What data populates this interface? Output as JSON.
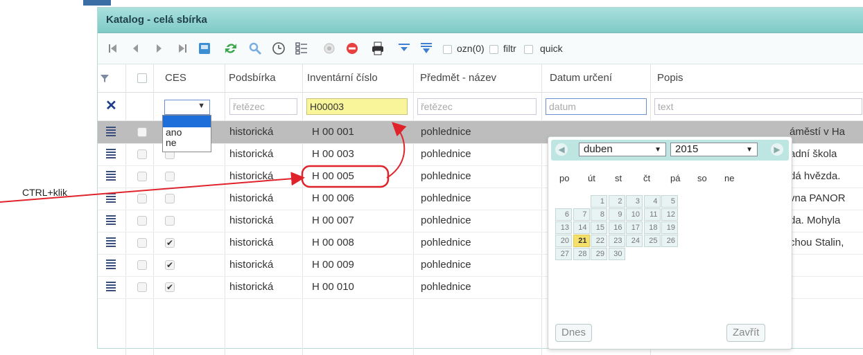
{
  "window": {
    "title": "Katalog - celá sbírka"
  },
  "toolbar": {
    "icons": [
      "first-icon",
      "prev-icon",
      "next-icon",
      "last-icon",
      "export-icon",
      "refresh-icon",
      "search-icon",
      "clock-icon",
      "columns-icon",
      "circle-icon",
      "delete-icon",
      "print-icon",
      "filter-down-icon",
      "filter-clear-icon"
    ],
    "ozn_label": "ozn(0)",
    "filtr_label": "filtr",
    "quick_label": "quick"
  },
  "columns": [
    "CES",
    "Podsbírka",
    "Inventární číslo",
    "Předmět - název",
    "Datum určení",
    "Popis"
  ],
  "filters": {
    "podsbirka_placeholder": "řetězec",
    "inventarni_value": "H00003",
    "predmet_placeholder": "řetězec",
    "datum_placeholder": "datum",
    "popis_placeholder": "text"
  },
  "ces_dropdown": {
    "options": [
      "",
      "ano",
      "ne"
    ]
  },
  "rows": [
    {
      "podsbirka": "historická",
      "inv": "H 00 001",
      "predmet": "pohlednice",
      "popis": "áměstí v Ha",
      "ces": false
    },
    {
      "podsbirka": "historická",
      "inv": "H 00 003",
      "predmet": "pohlednice",
      "popis": "adní škola",
      "ces": false
    },
    {
      "podsbirka": "historická",
      "inv": "H 00 005",
      "predmet": "pohlednice",
      "popis": "dá hvězda.",
      "ces": false
    },
    {
      "podsbirka": "historická",
      "inv": "H 00 006",
      "predmet": "pohlednice",
      "popis": "vna PANOR",
      "ces": false
    },
    {
      "podsbirka": "historická",
      "inv": "H 00 007",
      "predmet": "pohlednice",
      "popis": "da. Mohyla",
      "ces": false
    },
    {
      "podsbirka": "historická",
      "inv": "H 00 008",
      "predmet": "pohlednice",
      "popis": "chou Stalin,",
      "ces": true
    },
    {
      "podsbirka": "historická",
      "inv": "H 00 009",
      "predmet": "pohlednice",
      "popis": "",
      "ces": true
    },
    {
      "podsbirka": "historická",
      "inv": "H 00 010",
      "predmet": "pohlednice",
      "popis": "",
      "ces": true
    }
  ],
  "datepicker": {
    "month": "duben",
    "year": "2015",
    "weekdays": [
      "po",
      "út",
      "st",
      "čt",
      "pá",
      "so",
      "ne"
    ],
    "days": [
      "1",
      "2",
      "3",
      "4",
      "5",
      "6",
      "7",
      "8",
      "9",
      "10",
      "11",
      "12",
      "13",
      "14",
      "15",
      "16",
      "17",
      "18",
      "19",
      "20",
      "21",
      "22",
      "23",
      "24",
      "25",
      "26",
      "27",
      "28",
      "29",
      "30"
    ],
    "today": "21",
    "today_button": "Dnes",
    "close_button": "Zavřít"
  },
  "annotation": {
    "label": "CTRL+klik"
  },
  "colors": {
    "accent": "#7fcac6",
    "highlight": "#f9f59a",
    "annotation": "#e0232b"
  }
}
